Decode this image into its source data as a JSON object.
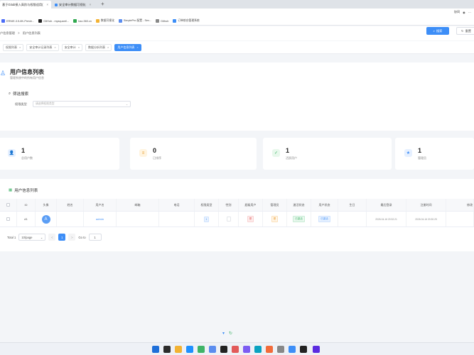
{
  "browser": {
    "tabs": [
      {
        "label": "基于Gitub接入高阶与权限适用(",
        "active": true
      },
      {
        "label": "安全审计数据可视化",
        "active": false
      }
    ],
    "new_tab": "+",
    "profile_label": "协同",
    "bookmarks": [
      {
        "label": "ERNIE-3.5-8K-Previe...",
        "color": "#4a6cf7"
      },
      {
        "label": "GitHub - mysquant/...",
        "color": "#222222"
      },
      {
        "label": "hao.360.cn",
        "color": "#2fa84f"
      },
      {
        "label": "数据可视化",
        "color": "#f2b233"
      },
      {
        "label": "SimplePro 配置 - Sex...",
        "color": "#5b8def"
      },
      {
        "label": "Github",
        "color": "#888888"
      },
      {
        "label": "订单前台管理系统",
        "color": "#3d8ef7"
      }
    ]
  },
  "breadcrumb": [
    "户信息管理",
    ">",
    "用户信息列表"
  ],
  "page_tabs": [
    {
      "label": "权限列表",
      "active": false
    },
    {
      "label": "安全审计记录列表",
      "active": false
    },
    {
      "label": "安全审计",
      "active": false
    },
    {
      "label": "数据分析列表",
      "active": false
    },
    {
      "label": "用户信息列表",
      "active": true
    }
  ],
  "header": {
    "title": "用户信息列表",
    "subtitle": "管理系统中的所有用户信息"
  },
  "filter": {
    "title": "筛选搜索",
    "field_label": "权限类型",
    "field_placeholder": "请选择权限类型",
    "search_button": "搜索",
    "reset_button": "重置"
  },
  "stats": [
    {
      "value": "1",
      "label": "总用户数",
      "icon": "users-icon",
      "bg": "#e6f0ff",
      "fg": "#3d8ef7"
    },
    {
      "value": "0",
      "label": "已排序",
      "icon": "sort-icon",
      "bg": "#fff4e0",
      "fg": "#e89b2e"
    },
    {
      "value": "1",
      "label": "活跃用户",
      "icon": "active-user-icon",
      "bg": "#e8f8ec",
      "fg": "#3fb468"
    },
    {
      "value": "1",
      "label": "管理员",
      "icon": "admin-icon",
      "bg": "#e6f0ff",
      "fg": "#3d8ef7"
    }
  ],
  "table": {
    "title": "用户信息列表",
    "headers": [
      "ID",
      "头像",
      "姓名",
      "用户名",
      "邮箱",
      "电话",
      "权限类型",
      "性别",
      "超级用户",
      "管理员",
      "激活状态",
      "用户状态",
      "生日",
      "最后登录",
      "注册时间",
      "修改"
    ],
    "rows": [
      {
        "id": "#1",
        "avatar_initial": "A",
        "name": "",
        "username": "admin",
        "email": "",
        "phone": "",
        "role": "1",
        "gender": "",
        "superuser": "是",
        "staff": "是",
        "active": "已激活",
        "status": "已激活",
        "birthday": "",
        "last_login": "2026-04-16 20:32:21",
        "date_joined": "2026-04-16 20:30:25",
        "edit": ""
      }
    ]
  },
  "pagination": {
    "total": "Total 1",
    "page_size": "10/page",
    "prev": "<",
    "current": "1",
    "next": ">",
    "goto_label": "Go to",
    "goto_value": "1"
  },
  "taskbar_colors": [
    "#1e6fd9",
    "#2b2b2b",
    "#f2b233",
    "#1e90ff",
    "#3fb468",
    "#5b8def",
    "#222222",
    "#e25a5a",
    "#7c5cf2",
    "#0aa2c0",
    "#f26b3a",
    "#888888",
    "#3d8ef7",
    "#222222",
    "#5b2be0"
  ]
}
